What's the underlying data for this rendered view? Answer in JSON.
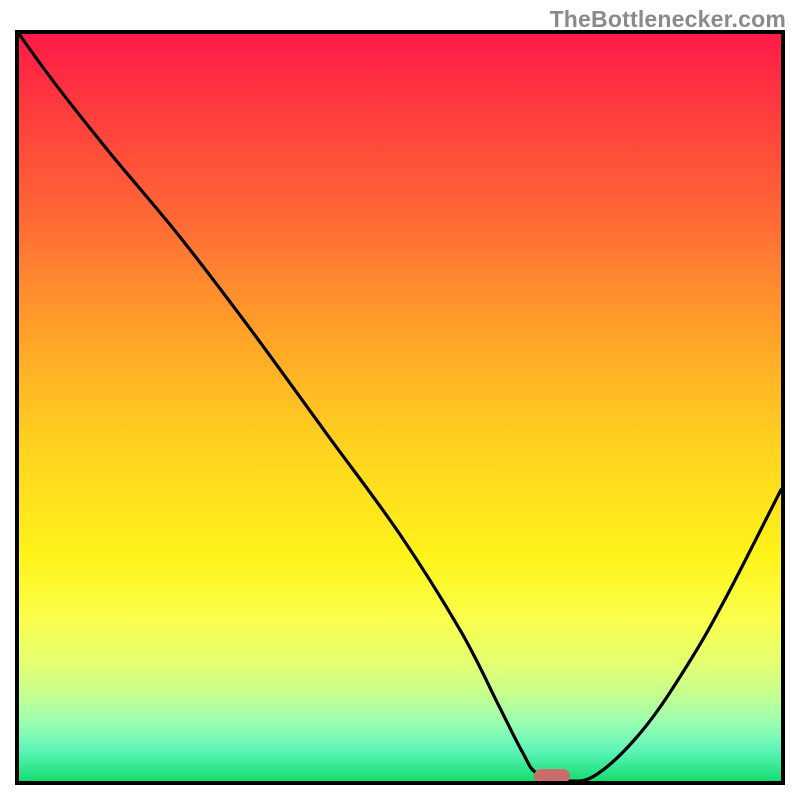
{
  "watermark_text": "TheBottlenecker.com",
  "chart_data": {
    "type": "line",
    "title": "",
    "xlabel": "",
    "ylabel": "",
    "xlim": [
      0,
      100
    ],
    "ylim": [
      0,
      100
    ],
    "series": [
      {
        "name": "bottleneck-curve",
        "x": [
          0,
          5,
          12,
          21,
          30,
          40,
          50,
          58,
          63,
          66,
          68,
          72,
          76,
          82,
          88,
          93,
          100
        ],
        "values": [
          100,
          93,
          84,
          73,
          61,
          47,
          33,
          20,
          10,
          4,
          1,
          0,
          1,
          7,
          16,
          25,
          39
        ]
      }
    ],
    "annotations": [
      {
        "name": "optimal-marker",
        "x": 70,
        "y": 0
      }
    ],
    "background_gradient": {
      "stops": [
        {
          "pos": 0,
          "color": "#ff1a49"
        },
        {
          "pos": 55,
          "color": "#ffd21f"
        },
        {
          "pos": 78,
          "color": "#faff4a"
        },
        {
          "pos": 100,
          "color": "#13dd6f"
        }
      ]
    }
  }
}
